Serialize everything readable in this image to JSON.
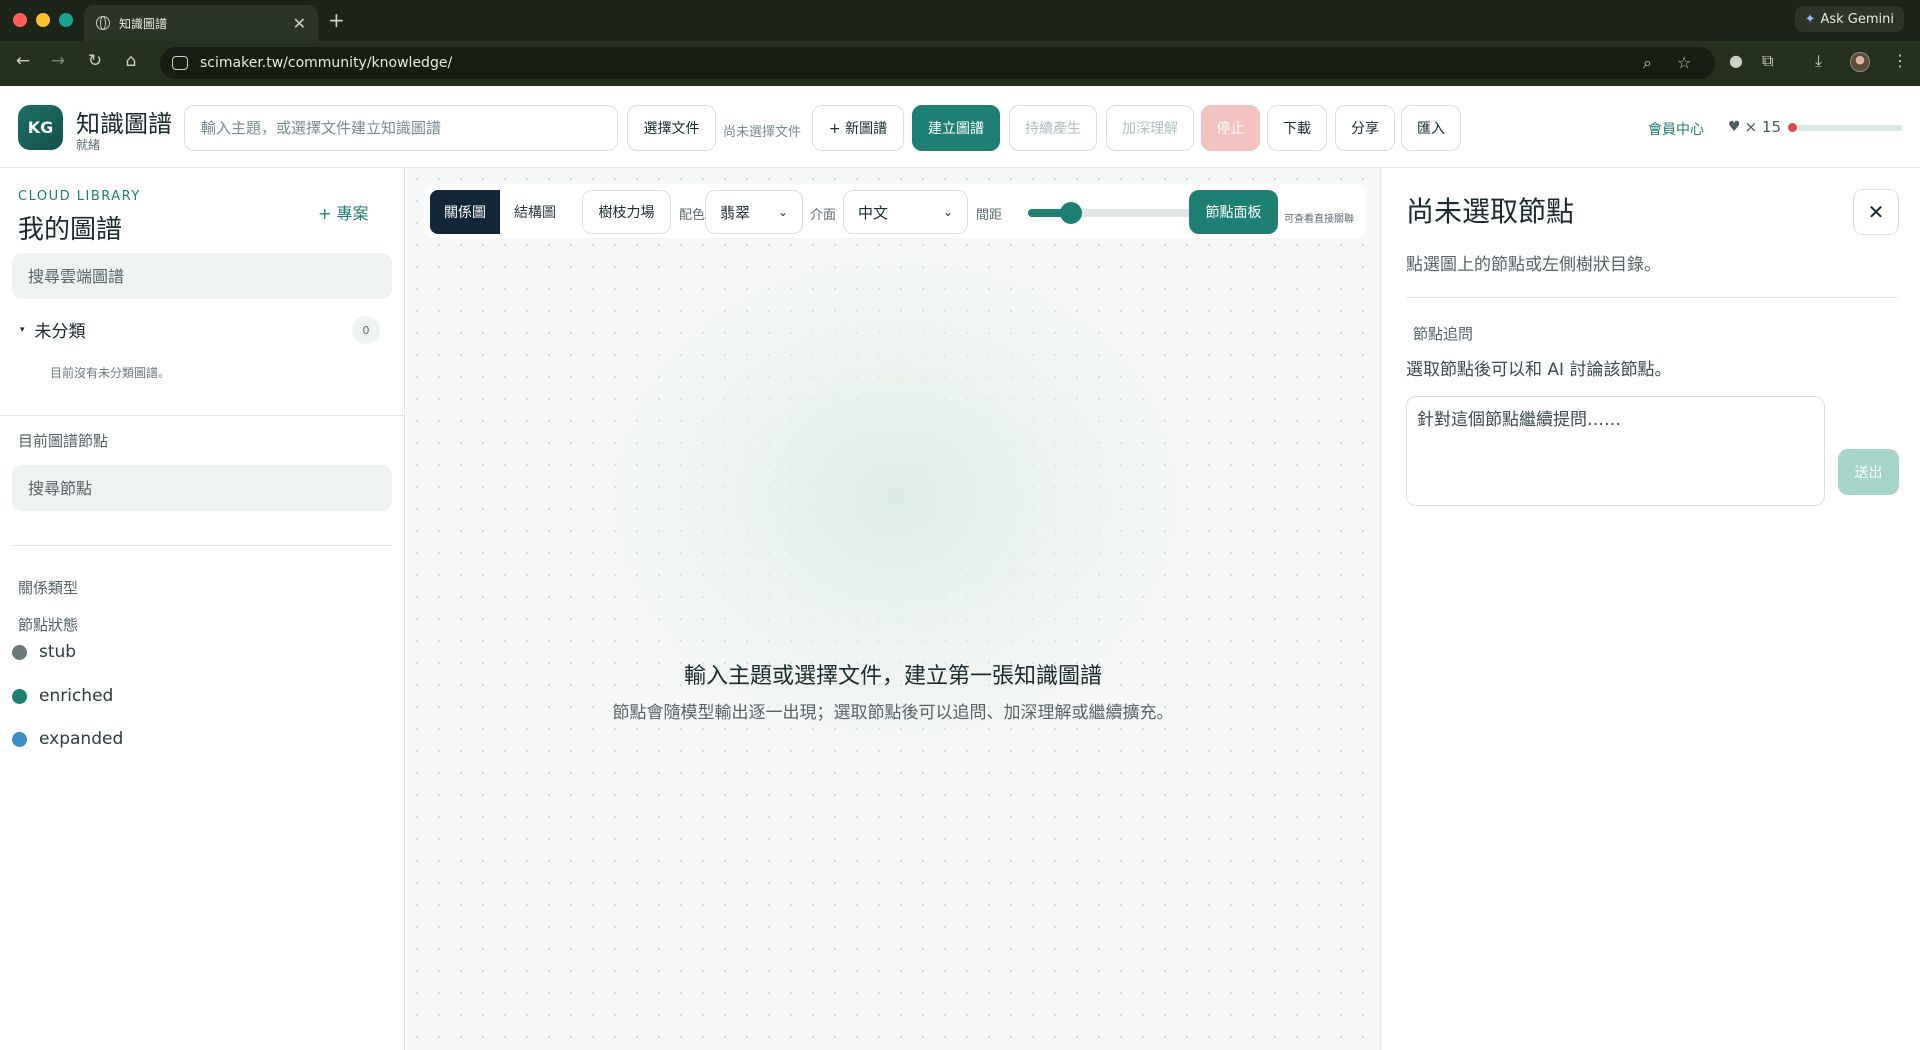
{
  "browser": {
    "tab_title": "知識圖譜",
    "tab_close": "✕",
    "new_tab": "+",
    "url": "scimaker.tw/community/knowledge/",
    "gemini_label": "Ask Gemini"
  },
  "header": {
    "logo_text": "KG",
    "app_title": "知識圖譜",
    "status": "就緒",
    "topic_placeholder": "輸入主題，或選擇文件建立知識圖譜",
    "choose_file": "選擇文件",
    "no_file": "尚未選擇文件",
    "new_graph": "+ 新圖譜",
    "build_graph": "建立圖譜",
    "continue_generate": "持續產生",
    "deepen": "加深理解",
    "stop": "停止",
    "download": "下載",
    "share": "分享",
    "import": "匯入",
    "member_center": "會員中心",
    "heart_icon": "♥",
    "heart_count": "× 15",
    "energy_level": 0.0
  },
  "sidebar": {
    "cloud_label": "CLOUD LIBRARY",
    "title": "我的圖譜",
    "add_project": "+ 專案",
    "search_placeholder": "搜尋雲端圖譜",
    "folder_caret": "▾",
    "folder_name": "未分類",
    "folder_count": "0",
    "empty_note": "目前沒有未分類圖譜。",
    "current_nodes_label": "目前圖譜節點",
    "node_search_placeholder": "搜尋節點",
    "relation_types_label": "關係類型",
    "node_status_label": "節點狀態",
    "legend": [
      {
        "label": "stub",
        "color": "#6b7679"
      },
      {
        "label": "enriched",
        "color": "#1e7f73"
      },
      {
        "label": "expanded",
        "color": "#3b8fc0"
      }
    ]
  },
  "toolbar": {
    "view_relation": "關係圖",
    "view_structure": "結構圖",
    "force_field": "樹枝力場",
    "color_label": "配色",
    "color_value": "翡翠",
    "ui_label": "介面",
    "ui_value": "中文",
    "spacing_label": "間距",
    "spacing_value": 0.25,
    "node_panel": "節點面板",
    "note": "可查看直接關聯",
    "chevron": "⌄"
  },
  "canvas": {
    "empty_title": "輸入主題或選擇文件，建立第一張知識圖譜",
    "empty_subtitle": "節點會隨模型輸出逐一出現；選取節點後可以追問、加深理解或繼續擴充。"
  },
  "panel": {
    "title": "尚未選取節點",
    "close": "✕",
    "subtitle": "點選圖上的節點或左側樹狀目錄。",
    "followup_label": "節點追問",
    "hint": "選取節點後可以和 AI 討論該節點。",
    "textarea_placeholder": "針對這個節點繼續提問……",
    "send": "送出"
  },
  "colors": {
    "accent": "#1e7f73",
    "navy": "#12263a",
    "stop": "#f3c3c1"
  }
}
